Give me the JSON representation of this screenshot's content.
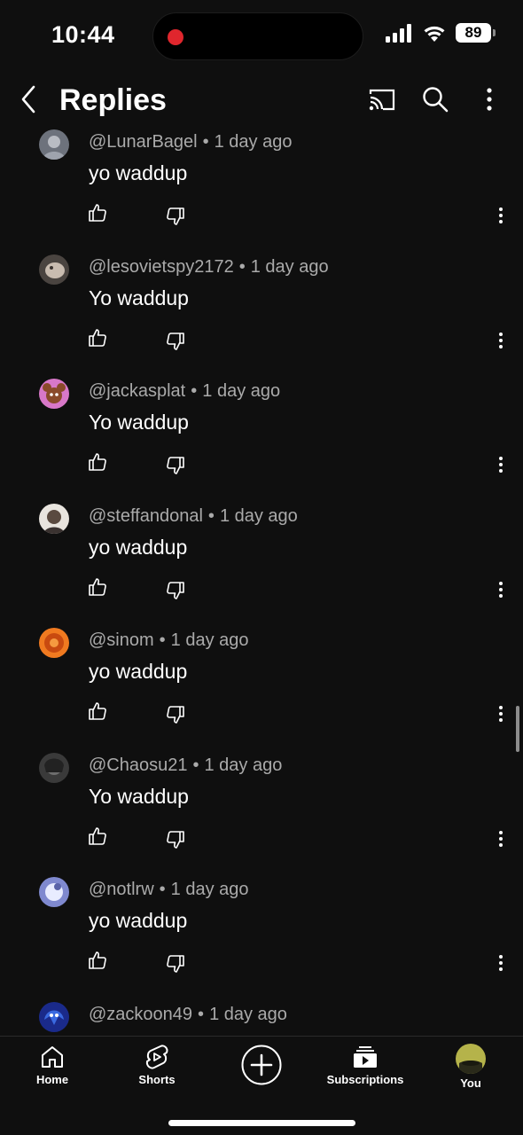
{
  "status_bar": {
    "time": "10:44",
    "battery": "89"
  },
  "header": {
    "title": "Replies"
  },
  "comments": [
    {
      "author": "@LunarBagel",
      "separator": "•",
      "time": "1 day ago",
      "text": "yo waddup",
      "avatar_color": "#8a8f9a"
    },
    {
      "author": "@lesovietspy2172",
      "separator": "•",
      "time": "1 day ago",
      "text": "Yo waddup",
      "avatar_color": "#a39a92"
    },
    {
      "author": "@jackasplat",
      "separator": "•",
      "time": "1 day ago",
      "text": "Yo waddup",
      "avatar_color": "#d67ac7"
    },
    {
      "author": "@steffandonal",
      "separator": "•",
      "time": "1 day ago",
      "text": "yo waddup",
      "avatar_color": "#c9c2b8"
    },
    {
      "author": "@sinom",
      "separator": "•",
      "time": "1 day ago",
      "text": "yo waddup",
      "avatar_color": "#e56a1e"
    },
    {
      "author": "@Chaosu21",
      "separator": "•",
      "time": "1 day ago",
      "text": "Yo waddup",
      "avatar_color": "#555555"
    },
    {
      "author": "@notlrw",
      "separator": "•",
      "time": "1 day ago",
      "text": "yo waddup",
      "avatar_color": "#9fa8e0"
    },
    {
      "author": "@zackoon49",
      "separator": "•",
      "time": "1 day ago",
      "text": "",
      "avatar_color": "#2748b8"
    }
  ],
  "bottom_nav": {
    "home": "Home",
    "shorts": "Shorts",
    "subscriptions": "Subscriptions",
    "you": "You"
  },
  "icons": {
    "back": "chevron-left-icon",
    "cast": "cast-icon",
    "search": "search-icon",
    "more": "more-vertical-icon",
    "like": "thumbs-up-icon",
    "dislike": "thumbs-down-icon",
    "create": "plus-circle-icon"
  },
  "colors": {
    "background": "#0f0f0f",
    "secondary_text": "#aaaaaa",
    "recording": "#e0262d",
    "you_avatar": "#b5b34a"
  }
}
